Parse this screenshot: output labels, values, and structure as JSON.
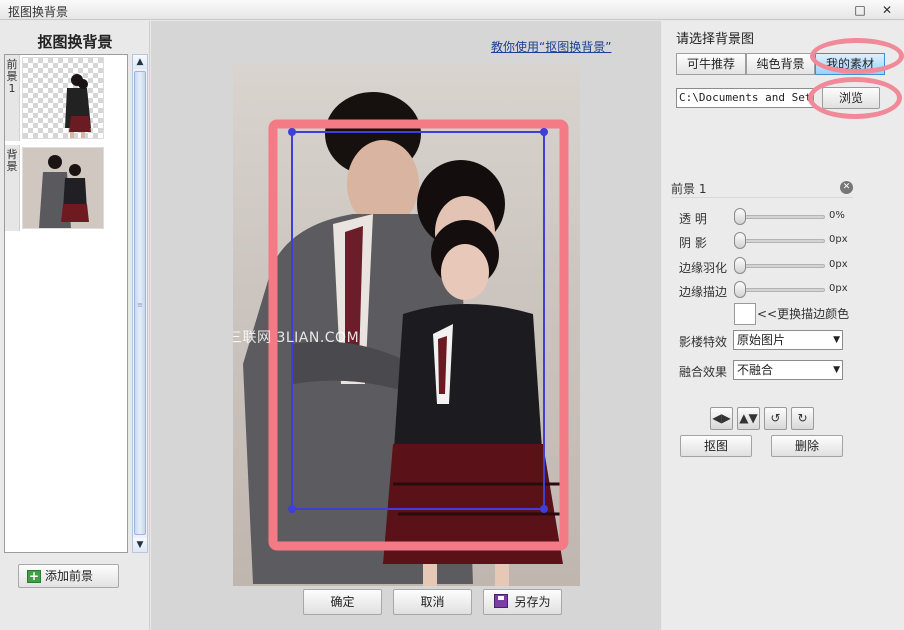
{
  "window": {
    "title": "抠图换背景",
    "restore_glyph": "□",
    "close_glyph": "✕"
  },
  "left": {
    "heading": "抠图换背景",
    "layers": [
      {
        "tag": "前景1",
        "name": "foreground-layer"
      },
      {
        "tag": "背景",
        "name": "background-layer"
      }
    ],
    "add_label": "添加前景",
    "scroll_up": "▲",
    "scroll_down": "▼",
    "grip": "≡"
  },
  "center": {
    "help_link": "教你使用“抠图换背景”",
    "watermark": "三联网 3LIAN.COM",
    "ok_label": "确定",
    "cancel_label": "取消",
    "save_as_label": "另存为"
  },
  "right": {
    "heading": "请选择背景图",
    "tabs": [
      "可牛推荐",
      "纯色背景",
      "我的素材"
    ],
    "active_tab": 2,
    "path_value": "C:\\Documents and Setti",
    "browse_label": "浏览",
    "layer_title": "前景 1",
    "layer_close": "✕",
    "sliders": [
      {
        "label": "透    明",
        "value": "0%",
        "level": 0
      },
      {
        "label": "阴    影",
        "value": "0px",
        "level": 0
      },
      {
        "label": "边缘羽化",
        "value": "0px",
        "level": 0
      },
      {
        "label": "边缘描边",
        "value": "0px",
        "level": 0
      }
    ],
    "change_color_label": "<<更换描边颜色",
    "effect_label": "影楼特效",
    "effect_value": "原始图片",
    "blend_label": "融合效果",
    "blend_value": "不融合",
    "dropdown_glyph": "▼",
    "tools": [
      "◀▶",
      "▲▼",
      "↺",
      "↻"
    ],
    "cutout_label": "抠图",
    "delete_label": "删除"
  },
  "colors": {
    "highlight_ring": "#f08a98",
    "selection_rect": "#f47b85",
    "selection_outline": "#3f3fd8",
    "link": "#1b3f95",
    "active_tab": "#9cd0f7"
  }
}
